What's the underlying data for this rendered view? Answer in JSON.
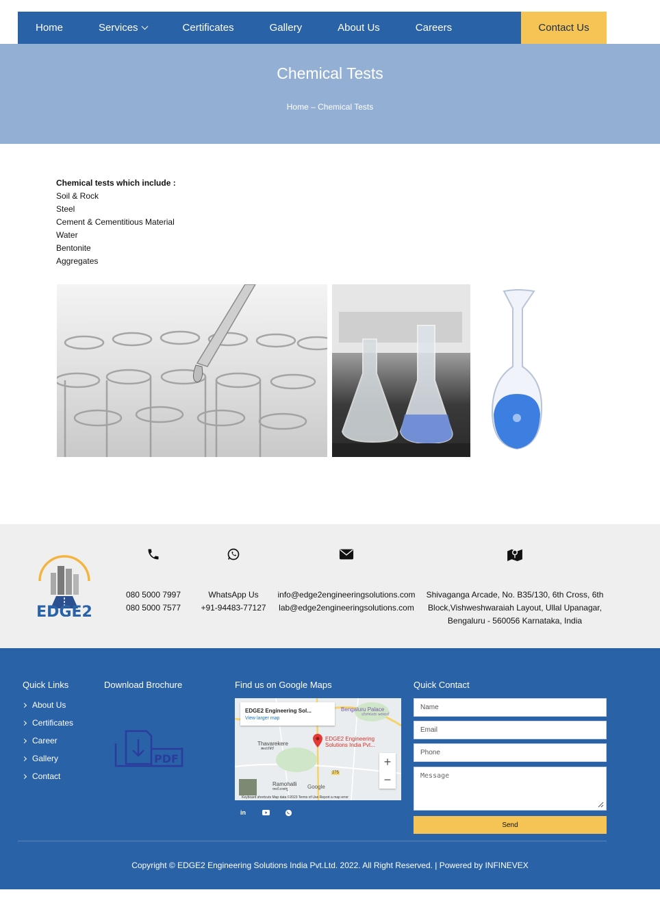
{
  "nav": {
    "items": [
      "Home",
      "Services",
      "Certificates",
      "Gallery",
      "About Us",
      "Careers"
    ],
    "contact": "Contact Us"
  },
  "banner": {
    "title": "Chemical Tests",
    "breadcrumb": "Home – Chemical Tests"
  },
  "content": {
    "intro": "Chemical tests which include :",
    "tests": [
      "Soil & Rock",
      "Steel",
      "Cement & Cementitious Material",
      "Water",
      "Bentonite",
      "Aggregates"
    ]
  },
  "contact_strip": {
    "logo_text": "EDGE2",
    "phones": [
      "080 5000 7997",
      "080 5000 7577"
    ],
    "whatsapp": [
      "WhatsApp Us",
      "+91-94483-77127"
    ],
    "emails": [
      "info@edge2engineeringsolutions.com",
      "lab@edge2engineeringsolutions.com"
    ],
    "address": [
      "Shivaganga Arcade, No. B35/130, 6th Cross, 6th",
      "Block,Vishweshwaraiah Layout, Ullal Upanagar,",
      "Bengaluru - 560056 Karnataka, India"
    ],
    "icons": [
      "phone-icon",
      "whatsapp-icon",
      "envelope-icon",
      "map-marker-icon"
    ]
  },
  "footer": {
    "quick_links_heading": "Quick Links",
    "quick_links": [
      "About Us",
      "Certificates",
      "Career",
      "Gallery",
      "Contact"
    ],
    "brochure_heading": "Download Brochure",
    "brochure_label": "PDF",
    "maps_heading": "Find us on Google Maps",
    "map": {
      "card_title": "EDGE2 Engineering Sol...",
      "card_link": "View larger map",
      "pin_label_1": "EDGE2 Engineering",
      "pin_label_2": "Solutions India Pvt...",
      "place_1": "Bengaluru Palace",
      "place_1_kn": "ಬೆಂಗಳೂರು ಅರಮನೆ",
      "place_2": "Thavarekere",
      "place_2_kn": "ತಾವರೆಕೆರೆ",
      "place_3": "Ramohalli",
      "place_3_kn": "ರಾಮೋಹಳ್ಳಿ",
      "road": "275",
      "brand": "Google",
      "zoom_in": "+",
      "zoom_out": "−",
      "footer_text": "Keyboard shortcuts   Map data ©2023   Terms of Use   Report a map error"
    },
    "social_icons": [
      "linkedin-icon",
      "youtube-icon",
      "whatsapp-icon"
    ],
    "social_labels": [
      "in"
    ],
    "contact_heading": "Quick Contact",
    "form": {
      "name_placeholder": "Name",
      "email_placeholder": "Email",
      "phone_placeholder": "Phone",
      "message_placeholder": "Message",
      "send": "Send"
    },
    "copyright": "Copyright © EDGE2 Engineering Solutions India Pvt.Ltd. 2022. All Right Reserved. | Powered by INFINEVEX"
  },
  "colors": {
    "nav_blue": "#2a62a8",
    "accent_yellow": "#f5c454",
    "banner_blue": "#93b0d4",
    "strip_gray": "#efefef"
  }
}
